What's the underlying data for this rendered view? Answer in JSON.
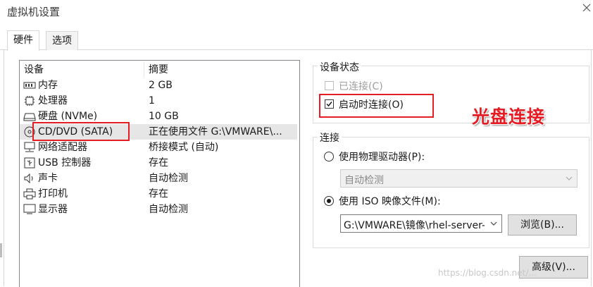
{
  "window": {
    "title": "虚拟机设置"
  },
  "tabs": [
    {
      "label": "硬件"
    },
    {
      "label": "选项"
    }
  ],
  "device_list": {
    "headers": {
      "device": "设备",
      "summary": "摘要"
    },
    "items": [
      {
        "icon": "memory-icon",
        "name": "内存",
        "summary": "2 GB"
      },
      {
        "icon": "processor-icon",
        "name": "处理器",
        "summary": "1"
      },
      {
        "icon": "hard-disk-icon",
        "name": "硬盘 (NVMe)",
        "summary": "10 GB"
      },
      {
        "icon": "cd-dvd-icon",
        "name": "CD/DVD (SATA)",
        "summary": "正在使用文件 G:\\VMWARE\\..."
      },
      {
        "icon": "network-adapter-icon",
        "name": "网络适配器",
        "summary": "桥接模式 (自动)"
      },
      {
        "icon": "usb-icon",
        "name": "USB 控制器",
        "summary": "存在"
      },
      {
        "icon": "sound-card-icon",
        "name": "声卡",
        "summary": "自动检测"
      },
      {
        "icon": "printer-icon",
        "name": "打印机",
        "summary": "存在"
      },
      {
        "icon": "display-icon",
        "name": "显示器",
        "summary": "自动检测"
      }
    ]
  },
  "device_status": {
    "legend": "设备状态",
    "connected": {
      "label": "已连接(C)",
      "checked": false,
      "enabled": false
    },
    "connect_at_power_on": {
      "label": "启动时连接(O)",
      "checked": true
    }
  },
  "connection": {
    "legend": "连接",
    "physical_drive": {
      "label": "使用物理驱动器(P):",
      "selected": false,
      "dropdown_value": "自动检测"
    },
    "iso_image": {
      "label": "使用 ISO 映像文件(M):",
      "selected": true,
      "path_value": "G:\\VMWARE\\镜像\\rhel-server-",
      "browse_label": "浏览(B)..."
    }
  },
  "advanced_button": "高级(V)...",
  "annotation": {
    "text": "光盘连接",
    "color": "#e51c23"
  },
  "watermark": "https://blog.csdn.net/...",
  "colors": {
    "highlight_red": "#e51c23",
    "selected_row": "#e6e6e6"
  }
}
